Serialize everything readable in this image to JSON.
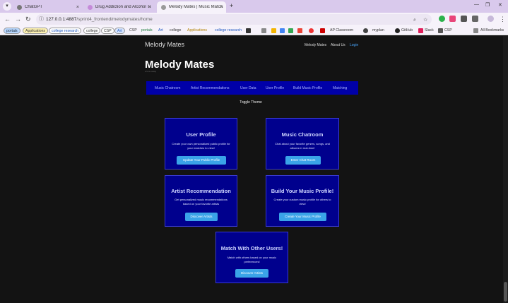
{
  "browser": {
    "tabs": [
      {
        "title": "ChatGPT",
        "close": "×"
      },
      {
        "title": "Drug Addiction and Alcohol Tr",
        "close": "×"
      },
      {
        "title": "Melody Mates | Music Matchin",
        "close": "×"
      }
    ],
    "new_tab": "+",
    "url_host": "127.0.0.1:4887",
    "url_path": "/sprint4_frontend/melodymates/home",
    "bookmarks": [
      "portals",
      "Applications",
      "college research",
      "college",
      "CSP",
      "Art",
      "CSP",
      "portals",
      "Art",
      "college",
      "Applications",
      "college research",
      "AP Classroom",
      "myplan",
      "GitHub",
      "Slack",
      "CSP"
    ],
    "all_bookmarks": "All Bookmarks"
  },
  "site": {
    "brand": "Melody Mates",
    "nav": [
      "Melody Mates",
      "About Us",
      "Login"
    ],
    "hero_title": "Melody Mates",
    "hero_sub": "a tune away",
    "menu": [
      "Music Chatroom",
      "Artist Recommendations",
      "User Data",
      "User Profile",
      "Build Music Profile",
      "Matching"
    ],
    "toggle": "Toggle Theme",
    "cards": [
      {
        "title": "User Profile",
        "desc": "Create your own personalized public profile for your matches to view!",
        "button": "Update Your Public Profile"
      },
      {
        "title": "Music Chatroom",
        "desc": "Chat about your favorite genres, songs, and albums in real-time!",
        "button": "Enter Chat Room"
      },
      {
        "title": "Artist Recommendation",
        "desc": "Get personalized music recommendations based on your favorite artists",
        "button": "Discover Artists"
      },
      {
        "title": "Build Your Music Profile!",
        "desc": "Create your custom music profile for others to view!",
        "button": "Create Your Music Profile"
      },
      {
        "title": "Match With Other Users!",
        "desc": "Match with others based on your music preferences!",
        "button": "Discover Artists"
      }
    ]
  },
  "colors": {
    "card_bg": "#00008d",
    "menu_bg": "#0000a8",
    "button": "#3aa3e8",
    "login_link": "#4aa8ff"
  }
}
